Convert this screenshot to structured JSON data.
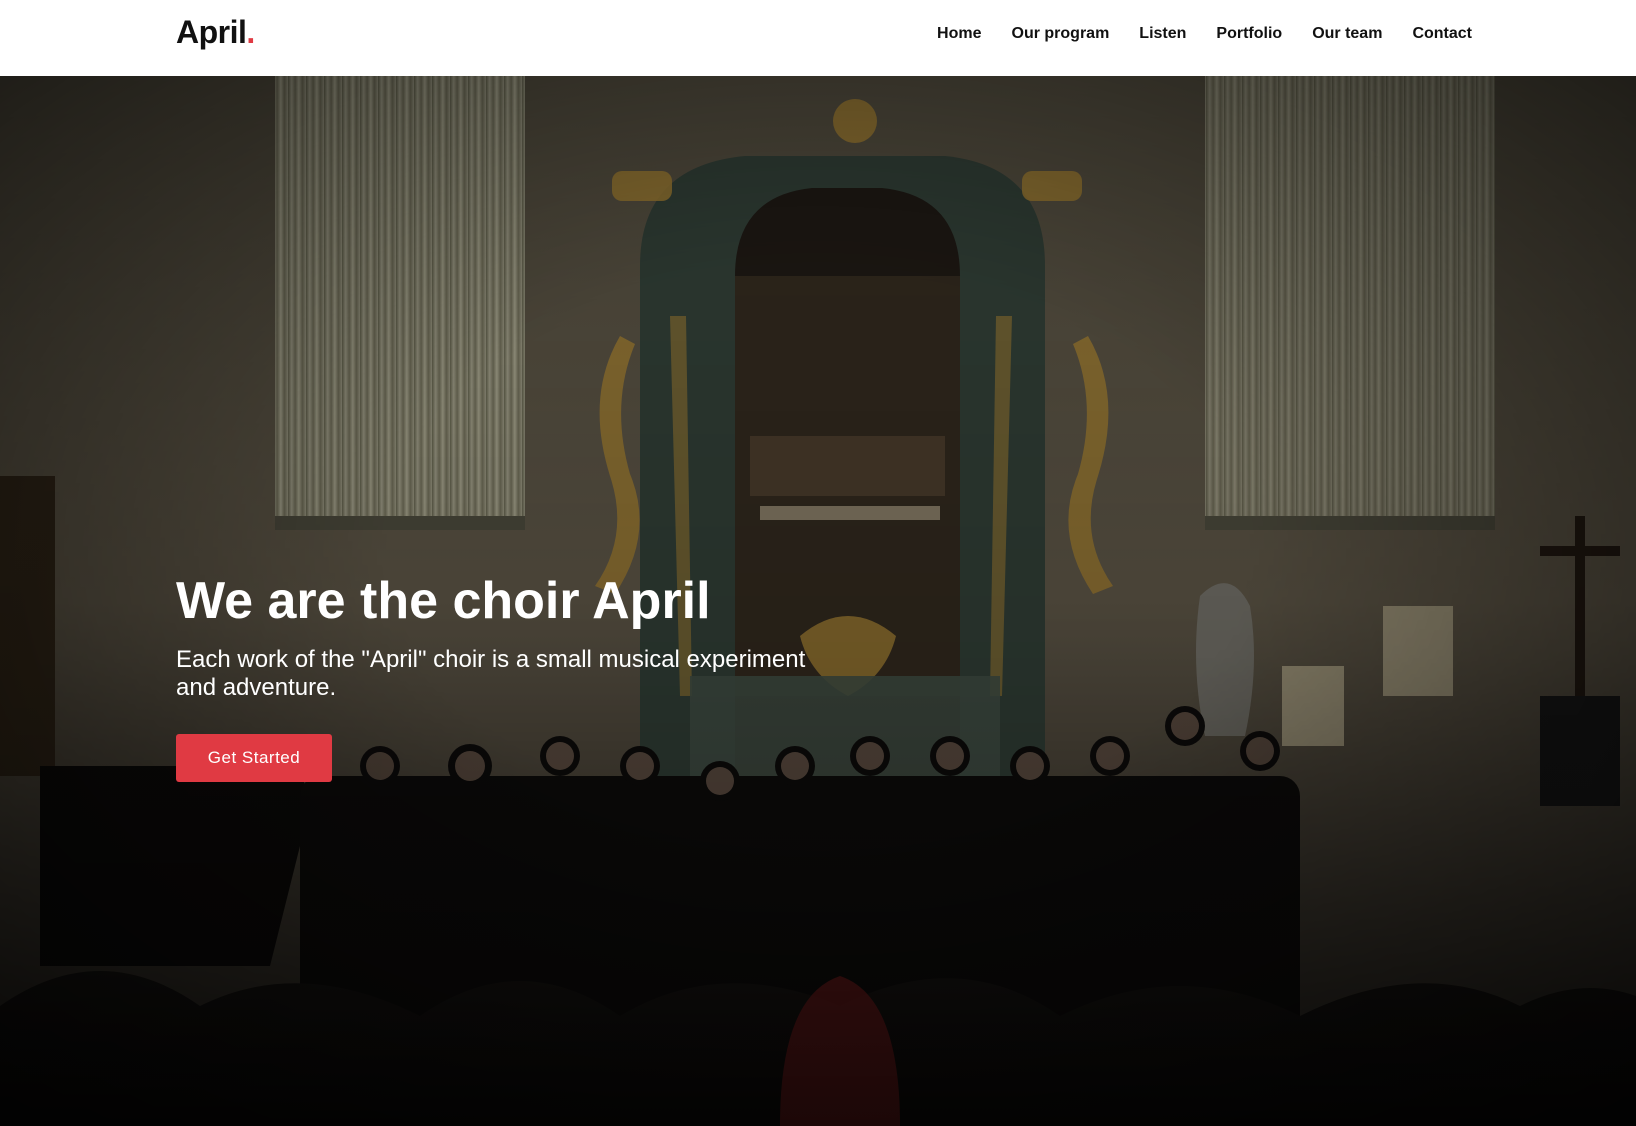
{
  "brand": {
    "name": "April",
    "dot": ".",
    "accent_color": "#e03a43"
  },
  "nav": {
    "items": [
      {
        "label": "Home"
      },
      {
        "label": "Our program"
      },
      {
        "label": "Listen"
      },
      {
        "label": "Portfolio"
      },
      {
        "label": "Our team"
      },
      {
        "label": "Contact"
      }
    ]
  },
  "hero": {
    "title": "We are the choir April",
    "subtitle": "Each work of the \"April\" choir is a small musical experiment and adventure.",
    "cta_label": "Get Started",
    "background_image": "choir-in-church-photo"
  }
}
